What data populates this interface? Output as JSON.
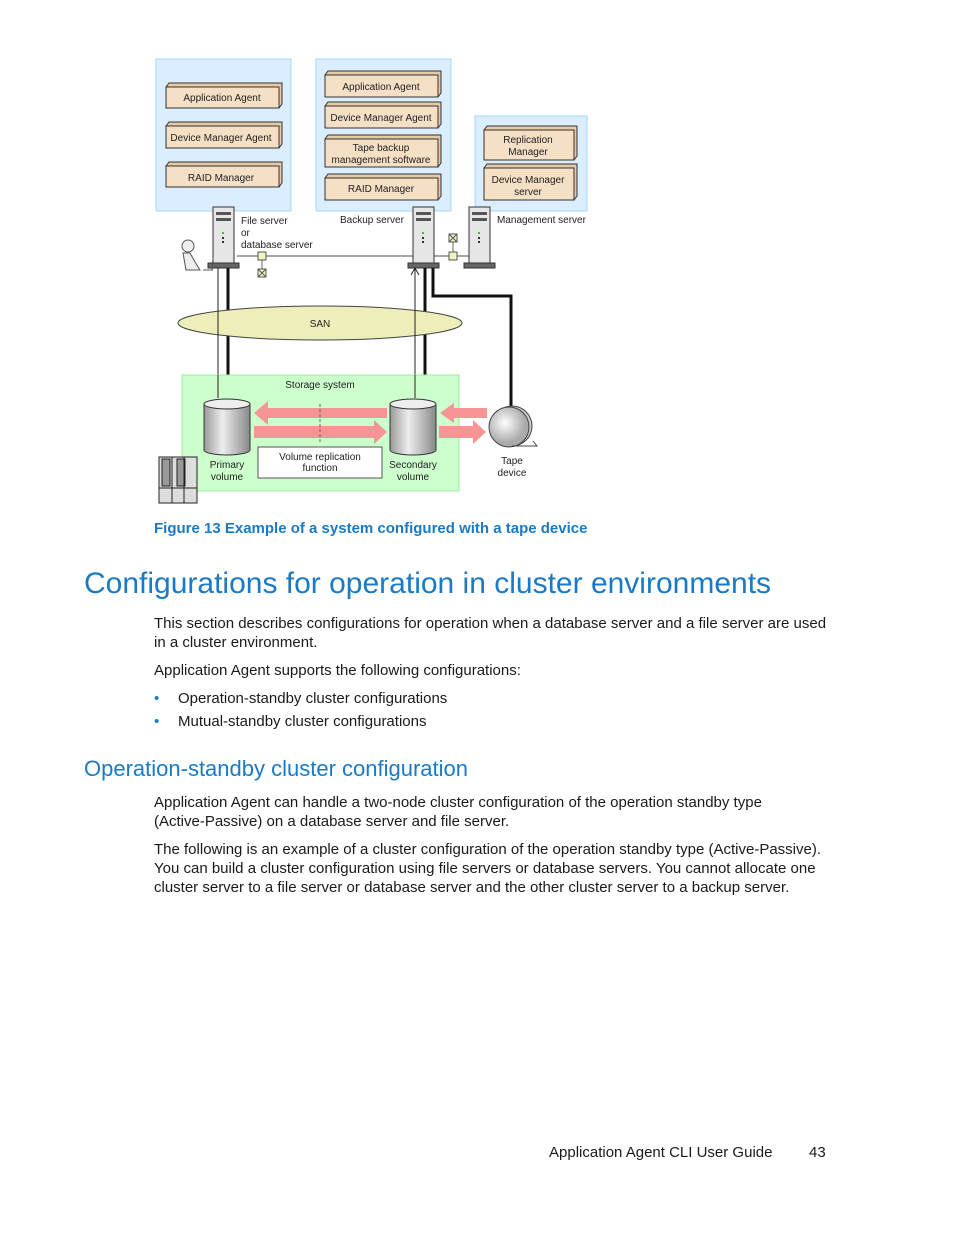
{
  "figure": {
    "file_server": {
      "components": [
        "Application Agent",
        "Device Manager Agent",
        "RAID Manager"
      ],
      "label_lines": [
        "File server",
        "or",
        "database server"
      ]
    },
    "backup_server": {
      "components": [
        "Application Agent",
        "Device Manager Agent",
        "Tape backup",
        "management software",
        "RAID Manager"
      ],
      "label": "Backup server"
    },
    "management_server": {
      "components": [
        "Replication",
        "Manager",
        "Device Manager",
        "server"
      ],
      "label": "Management server"
    },
    "san_label": "SAN",
    "storage_label": "Storage system",
    "primary_volume": [
      "Primary",
      "volume"
    ],
    "secondary_volume": [
      "Secondary",
      "volume"
    ],
    "replication_function": [
      "Volume replication",
      "function"
    ],
    "tape_device": [
      "Tape",
      "device"
    ],
    "colors": {
      "panel": "#dbeeff",
      "component": "#f5dfc5",
      "storage": "#ccffcc",
      "san": "#eeeebb",
      "arrow": "#f79494"
    },
    "caption": "Figure 13 Example of a system configured with a tape device"
  },
  "section": {
    "title": "Configurations for operation in cluster environments",
    "para1": "This section describes configurations for operation when a database server and a file server are used in a cluster environment.",
    "para2": "Application Agent supports the following configurations:",
    "bullets": [
      "Operation-standby cluster configurations",
      "Mutual-standby cluster configurations"
    ]
  },
  "subsection": {
    "title": "Operation-standby cluster configuration",
    "para1": "Application Agent can handle a two-node cluster configuration of the operation standby type (Active-Passive) on a database server and file server.",
    "para2": "The following is an example of a cluster configuration of the operation standby type (Active-Passive). You can build a cluster configuration using file servers or database servers. You cannot allocate one cluster server to a file server or database server and the other cluster server to a backup server."
  },
  "footer": {
    "title": "Application Agent CLI User Guide",
    "page": "43"
  }
}
